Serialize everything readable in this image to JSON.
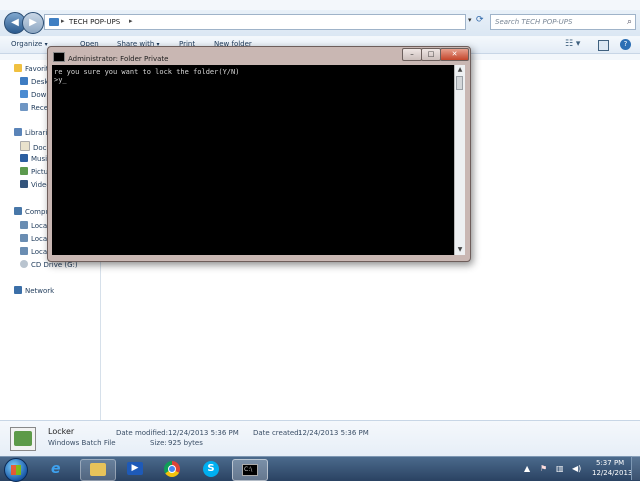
{
  "explorer": {
    "address": {
      "crumb": "TECH POP-UPS",
      "separator": "▸"
    },
    "search": {
      "placeholder": "Search TECH POP-UPS"
    },
    "toolbar": {
      "organize": "Organize",
      "open": "Open",
      "share_with": "Share with",
      "print": "Print",
      "new_folder": "New folder",
      "dropdown_glyph": "▾"
    },
    "nav_pane": {
      "favorites": "Favorites",
      "desktop": "Desktop",
      "downloads": "Downloads",
      "recent": "Recent Places",
      "libraries": "Libraries",
      "documents": "Documents",
      "music": "Music",
      "pictures": "Pictures",
      "videos": "Videos",
      "computer": "Computer",
      "local1": "Local Disk",
      "local2": "Local Disk",
      "local3": "Local Disk",
      "cd_drive": "CD Drive (G:)",
      "network": "Network"
    },
    "details": {
      "name": "Locker",
      "type": "Windows Batch File",
      "date_modified_label": "Date modified:",
      "date_modified": "12/24/2013 5:36 PM",
      "date_created_label": "Date created:",
      "date_created": "12/24/2013 5:36 PM",
      "size_label": "Size:",
      "size": "925 bytes"
    }
  },
  "console": {
    "title": "Administrator:  Folder Private",
    "buttons": {
      "minimize": "–",
      "maximize": "□",
      "close": "✕"
    },
    "lines": "re you sure you want to lock the folder(Y/N)\n>y_"
  },
  "taskbar": {
    "clock_time": "5:37 PM",
    "clock_date": "12/24/2013"
  },
  "icons": {
    "back": "back-arrow-icon",
    "forward": "forward-arrow-icon",
    "search": "search-icon",
    "refresh": "refresh-icon",
    "help": "help-icon"
  }
}
